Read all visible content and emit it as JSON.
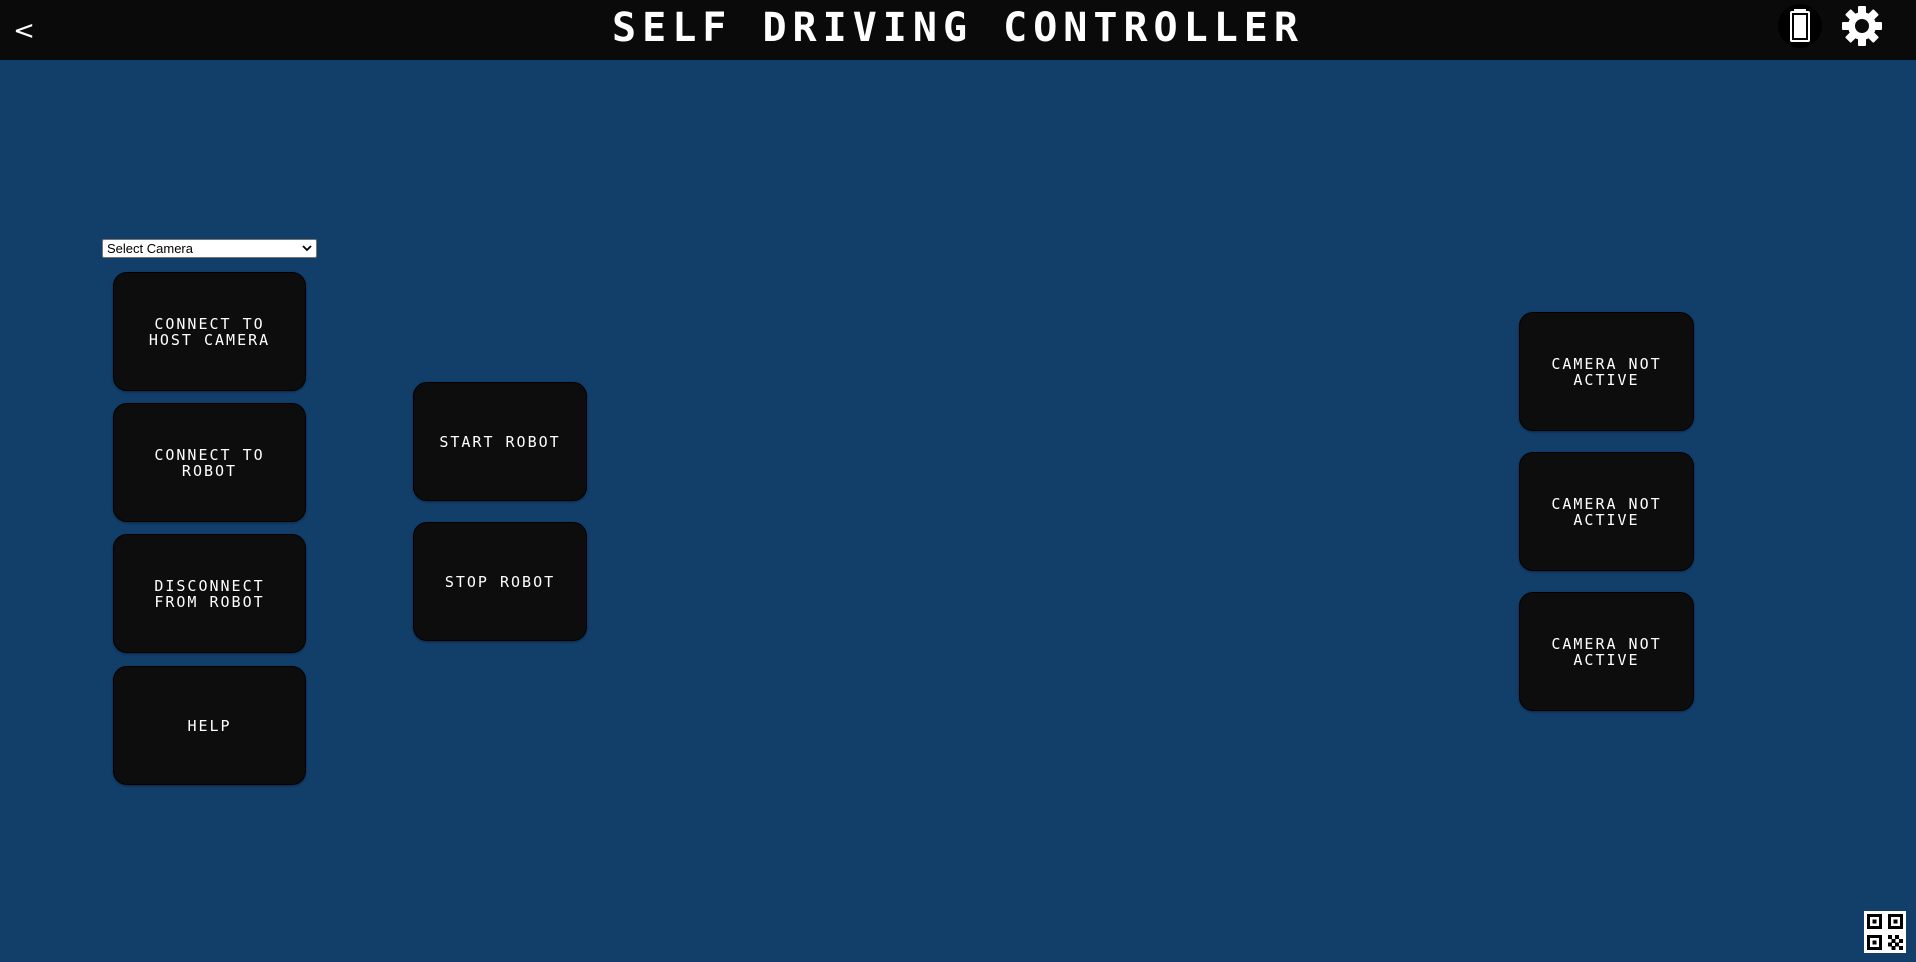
{
  "header": {
    "back_label": "<",
    "title": "SELF DRIVING CONTROLLER",
    "icons": [
      "battery-icon",
      "gear-icon"
    ]
  },
  "camera_select": {
    "selected": "Select Camera"
  },
  "left_buttons": {
    "connect_host_camera": "CONNECT TO HOST CAMERA",
    "connect_robot": "CONNECT TO ROBOT",
    "disconnect_robot": "DISCONNECT FROM ROBOT",
    "help": "HELP"
  },
  "robot_controls": {
    "start": "START ROBOT",
    "stop": "STOP ROBOT"
  },
  "camera_tiles": [
    {
      "status": "CAMERA NOT ACTIVE"
    },
    {
      "status": "CAMERA NOT ACTIVE"
    },
    {
      "status": "CAMERA NOT ACTIVE"
    }
  ],
  "footer": {
    "icons": [
      "qr-code-icon"
    ]
  },
  "colors": {
    "background": "#123e6a",
    "topbar": "#0a0a0a",
    "button": "#0d0d0d",
    "text": "#ffffff"
  }
}
